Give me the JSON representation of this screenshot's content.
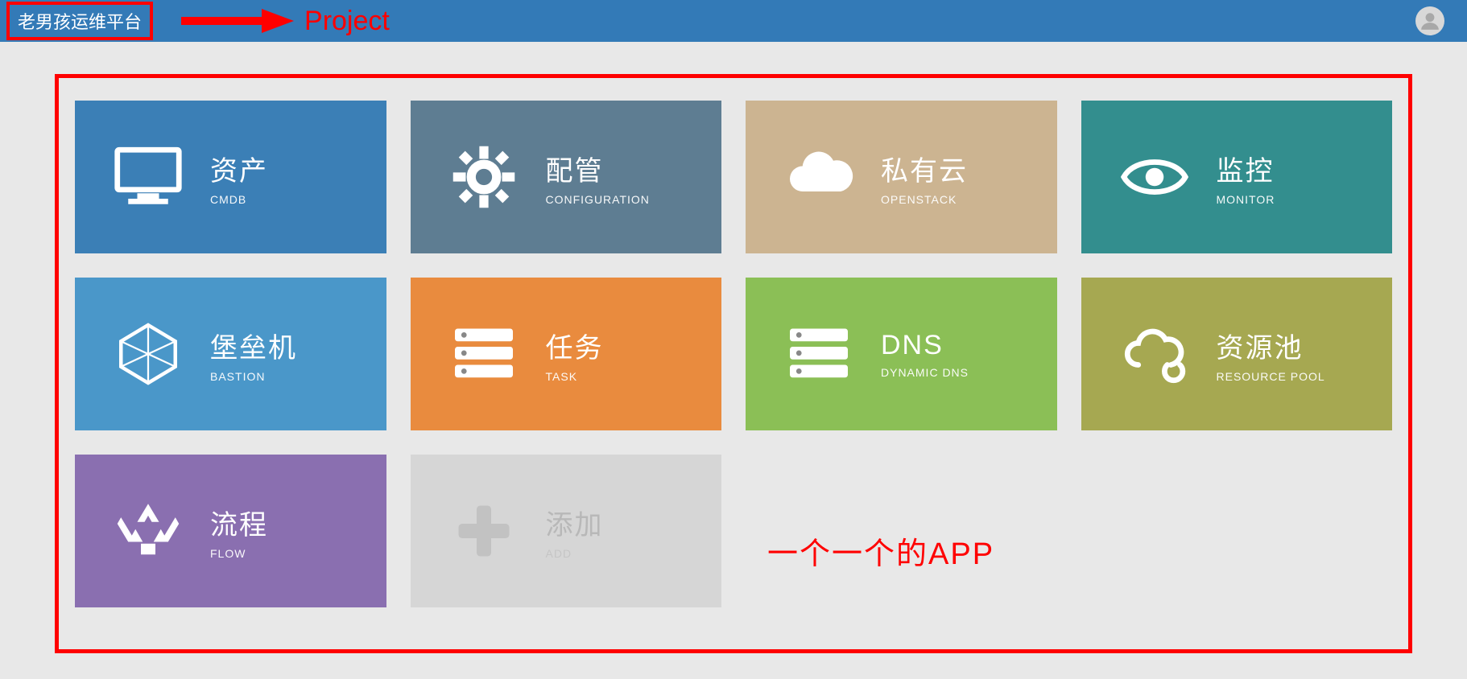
{
  "header": {
    "brand": "老男孩运维平台"
  },
  "annotations": {
    "project_label": "Project",
    "app_note": "一个一个的APP"
  },
  "tiles": [
    {
      "title": "资产",
      "subtitle": "CMDB",
      "color": "#3b7fb6",
      "icon": "monitor"
    },
    {
      "title": "配管",
      "subtitle": "CONFIGURATION",
      "color": "#5e7d92",
      "icon": "gear"
    },
    {
      "title": "私有云",
      "subtitle": "OPENSTACK",
      "color": "#ccb491",
      "icon": "cloud"
    },
    {
      "title": "监控",
      "subtitle": "MONITOR",
      "color": "#338e8e",
      "icon": "eye"
    },
    {
      "title": "堡垒机",
      "subtitle": "BASTION",
      "color": "#4a97c9",
      "icon": "polygon"
    },
    {
      "title": "任务",
      "subtitle": "TASK",
      "color": "#e98b3e",
      "icon": "server"
    },
    {
      "title": "DNS",
      "subtitle": "DYNAMIC DNS",
      "color": "#8bbf56",
      "icon": "server"
    },
    {
      "title": "资源池",
      "subtitle": "RESOURCE POOL",
      "color": "#a6a851",
      "icon": "cloudloop"
    },
    {
      "title": "流程",
      "subtitle": "FLOW",
      "color": "#8a6fb0",
      "icon": "recycle"
    },
    {
      "title": "添加",
      "subtitle": "ADD",
      "color": "#d6d6d6",
      "icon": "plus",
      "placeholder": true
    }
  ]
}
